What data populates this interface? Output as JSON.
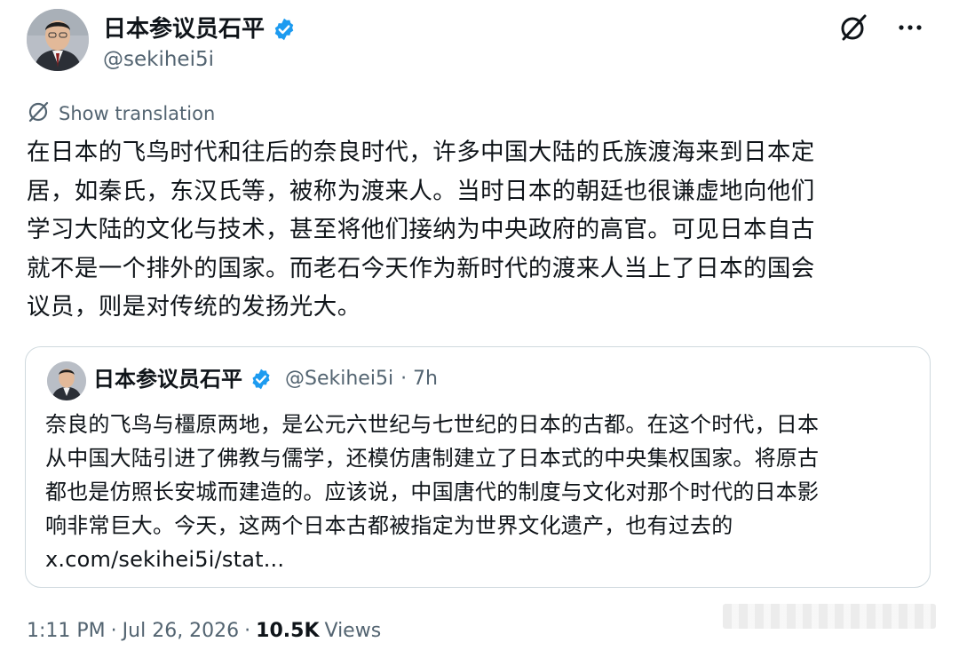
{
  "author": {
    "display_name": "日本参议员石平",
    "handle": "@sekihei5i"
  },
  "translation": {
    "label": "Show translation"
  },
  "tweet": {
    "lines": [
      "在日本的飞鸟时代和往后的奈良时代，许多中国大陆的氏族渡海来到日本定",
      "居，如秦氏，东汉氏等，被称为渡来人。当时日本的朝廷也很谦虚地向他们",
      "学习大陆的文化与技术，甚至将他们接纳为中央政府的高官。可见日本自古",
      "就不是一个排外的国家。而老石今天作为新时代的渡来人当上了日本的国会",
      "议员，则是对传统的发扬光大。"
    ]
  },
  "quote": {
    "display_name": "日本参议员石平",
    "handle": "@Sekihei5i",
    "time": "· 7h",
    "lines": [
      "奈良的飞鸟与橿原两地，是公元六世纪与七世纪的日本的古都。在这个时代，日本",
      "从中国大陆引进了佛教与儒学，还模仿唐制建立了日本式的中央集权国家。将原古",
      "都也是仿照长安城而建造的。应该说，中国唐代的制度与文化对那个时代的日本影",
      "响非常巨大。今天，这两个日本古都被指定为世界文化遗产，也有过去的",
      "x.com/sekihei5i/stat..."
    ]
  },
  "footer": {
    "time": "1:11 PM",
    "date": "Jul 26, 2026",
    "views_count": "10.5K",
    "views_label": "Views",
    "separator": "·"
  },
  "icons": {
    "verified": "verified-badge-icon",
    "grok": "grok-icon",
    "more": "more-icon",
    "translate": "translate-icon"
  },
  "colors": {
    "verified": "#1d9bf0",
    "secondary_text": "#536471",
    "primary_text": "#0f1419",
    "border": "#cfd9de"
  }
}
